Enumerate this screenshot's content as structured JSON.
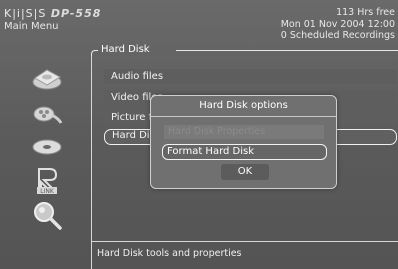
{
  "header": {
    "logo_text": "K|i|S|S",
    "logo_model": "DP-558",
    "menu_label": "Main Menu",
    "status": {
      "free_space": "113 Hrs free",
      "datetime": "Mon 01 Nov 2004 12:00",
      "scheduled": "0 Scheduled Recordings"
    }
  },
  "section": {
    "title": "Hard Disk"
  },
  "sidebar_icons": [
    {
      "icon": "hard-disk-icon"
    },
    {
      "icon": "film-reel-icon"
    },
    {
      "icon": "disc-icon"
    },
    {
      "icon": "kiss-link-icon",
      "label": "LINK"
    },
    {
      "icon": "magnifier-icon"
    }
  ],
  "menu": {
    "items": [
      {
        "label": "Audio files"
      },
      {
        "label": "Video files"
      },
      {
        "label": "Picture files"
      },
      {
        "label": "Hard Disk tools"
      }
    ]
  },
  "dialog": {
    "title": "Hard Disk options",
    "options": [
      {
        "label": "Hard Disk Properties",
        "enabled": false
      },
      {
        "label": "Format Hard Disk",
        "enabled": true,
        "selected": true
      }
    ],
    "ok_label": "OK"
  },
  "footer": {
    "help_text": "Hard Disk tools and properties"
  },
  "colors": {
    "background": "#5d5d5d",
    "text": "#ffffff",
    "highlight_border": "#f0f0f0",
    "disabled_text": "#8b8b8b"
  }
}
